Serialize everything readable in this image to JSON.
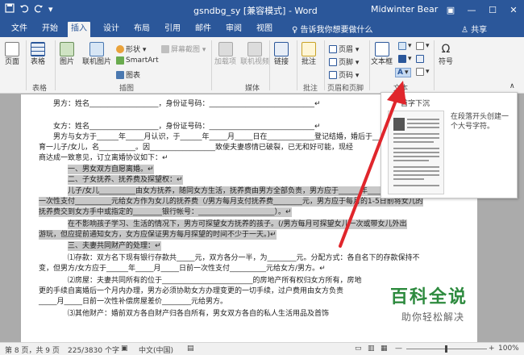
{
  "titlebar": {
    "save_icon": "save-icon",
    "undo_icon": "undo-icon",
    "redo_icon": "redo-icon",
    "doc_title": "gsndbg_sy [兼容模式] - Word",
    "user": "Midwinter Bear",
    "min": "—",
    "max": "☐",
    "close": "✕",
    "ribbon_opts": "▣"
  },
  "tabs": [
    "文件",
    "开始",
    "插入",
    "设计",
    "布局",
    "引用",
    "邮件",
    "审阅",
    "视图"
  ],
  "tellme": "♀ 告诉我你想要做什么",
  "share": "♙ 共享",
  "ribbon": {
    "page": "页面",
    "table": "表格",
    "image": "图片",
    "online_image": "联机图片",
    "shapes": "形状 ▾",
    "smartart": "SmartArt",
    "chart": "图表",
    "screenshot": "屏幕截图 ▾",
    "addins": "加载项",
    "online_video": "联机视频",
    "link": "链接",
    "comment": "批注",
    "header": "页眉 ▾",
    "footer": "页脚 ▾",
    "pagenum": "页码 ▾",
    "textbox": "文本框",
    "symbol": "符号",
    "omega": "Ω",
    "groups": {
      "table": "表格",
      "illustrations": "插图",
      "media": "媒体",
      "comments": "批注",
      "headerfooter": "页眉和页脚",
      "text": "文本"
    }
  },
  "tooltip": {
    "title": "首字下沉",
    "desc": "在段落开头创建一个大号字符。"
  },
  "doc": {
    "lines": [
      "男方：姓名___________________，身份证号码：_____________________________↵",
      "",
      "女方：姓名___________________，身份证号码：_____________________________↵",
      "男方与女方于______年_____月认识，于______年_____月_____日在_____________登记结婚，婚后于______",
      "育一儿子/女儿，名__________。因__________________致使夫妻感情已破裂，已无和好可能，现经",
      "商达成一致意见，订立离婚协议如下：↵",
      "一、男女双方自愿离婚。↵",
      "二、子女抚养、抚养费及探望权：↵",
      "儿子/女儿__________由女方抚养，随同女方生活，抚养费由男方全部负责，男方应于______年_____月_____日前",
      "一次性支付__________元给女方作为女儿的抚养费（/男方每月支付抚养费________元，男方应于每月的1-5日前将女儿的",
      "抚养费交到女方手中或指定的________银行帐号：_____________________）。↵",
      "在不影响孩子学习、生活的情况下，男方可探望女方抚养的孩子。(/男方每月可探望女儿一次或带女儿外出",
      "游玩，但应提前通知女方，女方应保证男方每月探望的时间不少于一天。)↵",
      "三、夫妻共同财产的处理：↵",
      "⑴存款：双方名下现有银行存款共_____元，双方各分一半，为________元。分配方式：各自名下的存款保持不",
      "变，但男方/女方应于______年_____月_____日前一次性支付__________元给女方/男方。↵",
      "⑵房屋：夫妻共同所有的位于_________________________的房地产所有权归女方所有，房地",
      "更的手续自离婚后一个月内办理，男方必须协助女方办理变更的一切手续，过户费用由女方负责",
      "_____月_____日前一次性补偿房屋差价________元给男方。",
      "⑶其他财产：婚前双方各自财产归各自所有，男女双方各自的私人生活用品及首饰"
    ]
  },
  "status": {
    "page": "第 8 页，共 9 页",
    "words": "225/3830 个字",
    "lang": "中文(中国)",
    "zoom": "100%",
    "zoom_minus": "—",
    "zoom_plus": "+"
  },
  "watermark": {
    "main": "百科全说",
    "sub": "助你轻松解决"
  },
  "colors": {
    "brand": "#2b579a",
    "arrow": "#e0262c",
    "watermark": "#2d8a3e"
  }
}
